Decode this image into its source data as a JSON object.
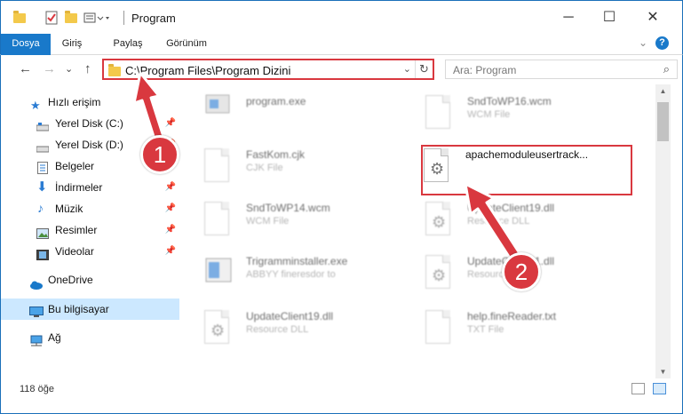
{
  "window": {
    "title": "Program",
    "minimize": "─",
    "maximize": "☐",
    "close": "✕"
  },
  "ribbon": {
    "tabs": [
      "Dosya",
      "Giriş",
      "Paylaş",
      "Görünüm"
    ],
    "expand": "⌄",
    "help": "?"
  },
  "nav": {
    "back": "←",
    "forward": "→",
    "recent": "⌄",
    "up": "↑",
    "address": "C:\\Program Files\\Program Dizini",
    "address_dropdown": "⌄",
    "refresh": "↻",
    "search_placeholder": "Ara: Program",
    "search_icon": "⌕"
  },
  "sidebar": {
    "items": [
      {
        "label": "Hızlı erişim",
        "icon": "star-icon"
      },
      {
        "label": "Yerel Disk (C:)",
        "icon": "drive-icon",
        "pinned": true
      },
      {
        "label": "Yerel Disk (D:)",
        "icon": "drive-icon",
        "pinned": true
      },
      {
        "label": "Belgeler",
        "icon": "document-icon",
        "pinned": true
      },
      {
        "label": "İndirmeler",
        "icon": "download-icon",
        "pinned": true
      },
      {
        "label": "Müzik",
        "icon": "music-icon",
        "pinned": true
      },
      {
        "label": "Resimler",
        "icon": "pictures-icon",
        "pinned": true
      },
      {
        "label": "Videolar",
        "icon": "video-icon",
        "pinned": true
      },
      {
        "label": "OneDrive",
        "icon": "cloud-icon"
      },
      {
        "label": "Bu bilgisayar",
        "icon": "computer-icon",
        "selected": true
      },
      {
        "label": "Ağ",
        "icon": "network-icon"
      }
    ]
  },
  "files": [
    {
      "name": "program.exe",
      "type": "",
      "icon": "exe-icon"
    },
    {
      "name": "SndToWP16.wcm",
      "type": "WCM File",
      "icon": "page-icon"
    },
    {
      "name": "FastKom.cjk",
      "type": "CJK File",
      "icon": "page-icon"
    },
    {
      "name": "apachemoduleusertrack...",
      "type": "",
      "icon": "dll-gear-icon",
      "highlighted": true
    },
    {
      "name": "SndToWP14.wcm",
      "type": "WCM File",
      "icon": "page-icon"
    },
    {
      "name": "UpdateClient19.dll",
      "type": "Resource DLL",
      "icon": "dll-gear-icon"
    },
    {
      "name": "Trigramminstaller.exe",
      "type": "ABBYY fineresdor to",
      "icon": "exe-icon"
    },
    {
      "name": "UpdateClient21.dll",
      "type": "Resource DLL",
      "icon": "dll-gear-icon"
    },
    {
      "name": "UpdateClient19.dll",
      "type": "Resource DLL",
      "icon": "dll-gear-icon"
    },
    {
      "name": "help.fineReader.txt",
      "type": "TXT File",
      "icon": "page-icon"
    }
  ],
  "status": {
    "count": "118 öğe"
  },
  "callouts": [
    "1",
    "2"
  ],
  "colors": {
    "accent": "#1979ca",
    "highlight": "#d9383f"
  }
}
